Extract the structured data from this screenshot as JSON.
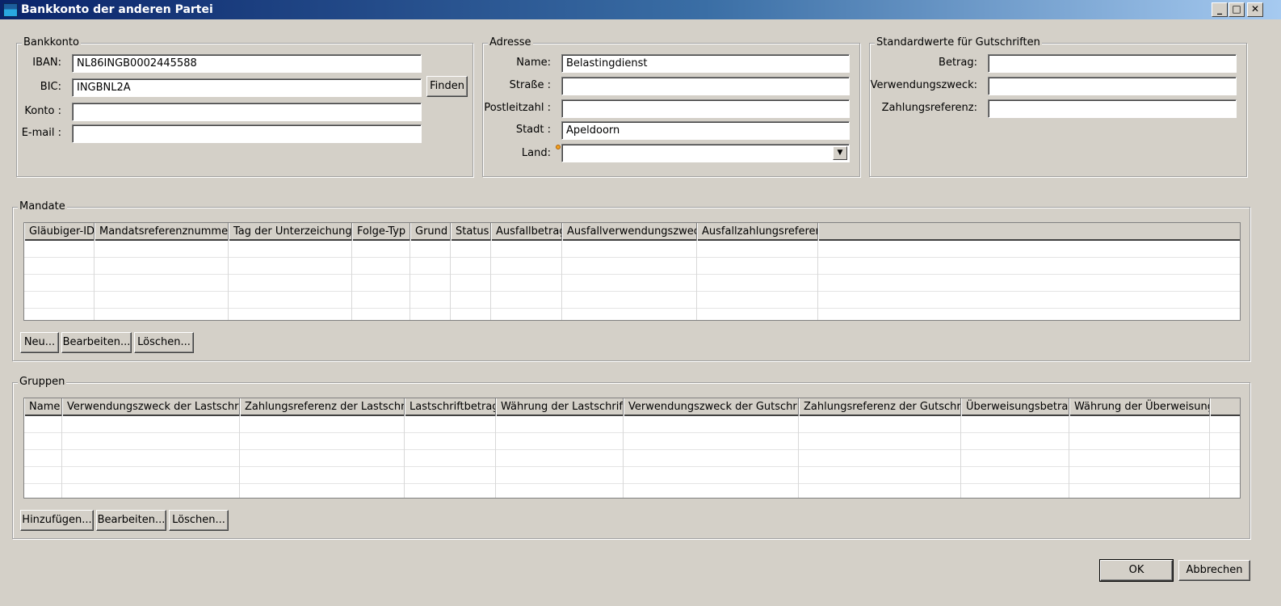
{
  "window": {
    "title": "Bankkonto der anderen Partei",
    "minimize_glyph": "_",
    "maximize_glyph": "□",
    "close_glyph": "✕"
  },
  "bank": {
    "legend": "Bankkonto",
    "iban_label": "IBAN:",
    "iban_value": "NL86INGB0002445588",
    "bic_label": "BIC:",
    "bic_value": "INGBNL2A",
    "find_button": "Finden",
    "konto_label": "Konto :",
    "konto_value": "",
    "email_label": "E-mail :",
    "email_value": ""
  },
  "address": {
    "legend": "Adresse",
    "name_label": "Name:",
    "name_value": "Belastingdienst",
    "street_label": "Straße :",
    "street_value": "",
    "zip_label": "Postleitzahl :",
    "zip_value": "",
    "city_label": "Stadt :",
    "city_value": "Apeldoorn",
    "country_label": "Land:",
    "country_value": ""
  },
  "defaults": {
    "legend": "Standardwerte für Gutschriften",
    "amount_label": "Betrag:",
    "amount_value": "",
    "purpose_label": "Verwendungszweck:",
    "purpose_value": "",
    "reference_label": "Zahlungsreferenz:",
    "reference_value": ""
  },
  "mandates": {
    "legend": "Mandate",
    "columns": [
      "Gläubiger-ID",
      "Mandatsreferenznummer",
      "Tag der Unterzeichung",
      "Folge-Typ",
      "Grund",
      "Status",
      "Ausfallbetrag",
      "Ausfallverwendungszweck",
      "Ausfallzahlungsreferenz"
    ],
    "buttons": {
      "new": "Neu...",
      "edit": "Bearbeiten...",
      "delete": "Löschen..."
    }
  },
  "groups": {
    "legend": "Gruppen",
    "columns": [
      "Name",
      "Verwendungszweck der Lastschrift",
      "Zahlungsreferenz der Lastschrift",
      "Lastschriftbetrag",
      "Währung der Lastschrift",
      "Verwendungszweck der Gutschrift",
      "Zahlungsreferenz der Gutschrift",
      "Überweisungsbetrag",
      "Währung der Überweisung"
    ],
    "buttons": {
      "add": "Hinzufügen...",
      "edit": "Bearbeiten...",
      "delete": "Löschen..."
    }
  },
  "footer": {
    "ok": "OK",
    "cancel": "Abbrechen"
  },
  "icons": {
    "dropdown": "chevron-down-icon",
    "warning": "warning-icon"
  },
  "colors": {
    "dialog_bg": "#d4d0c8",
    "title_start": "#0a246a",
    "title_end": "#a6caf0"
  }
}
